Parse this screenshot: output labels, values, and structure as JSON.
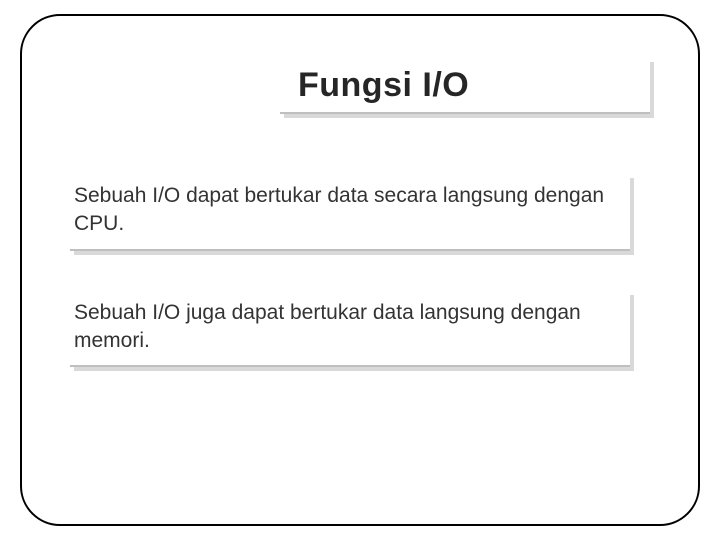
{
  "title": "Fungsi I/O",
  "paragraphs": [
    "Sebuah I/O dapat bertukar data secara langsung dengan CPU.",
    "Sebuah I/O juga dapat bertukar data langsung dengan memori."
  ]
}
